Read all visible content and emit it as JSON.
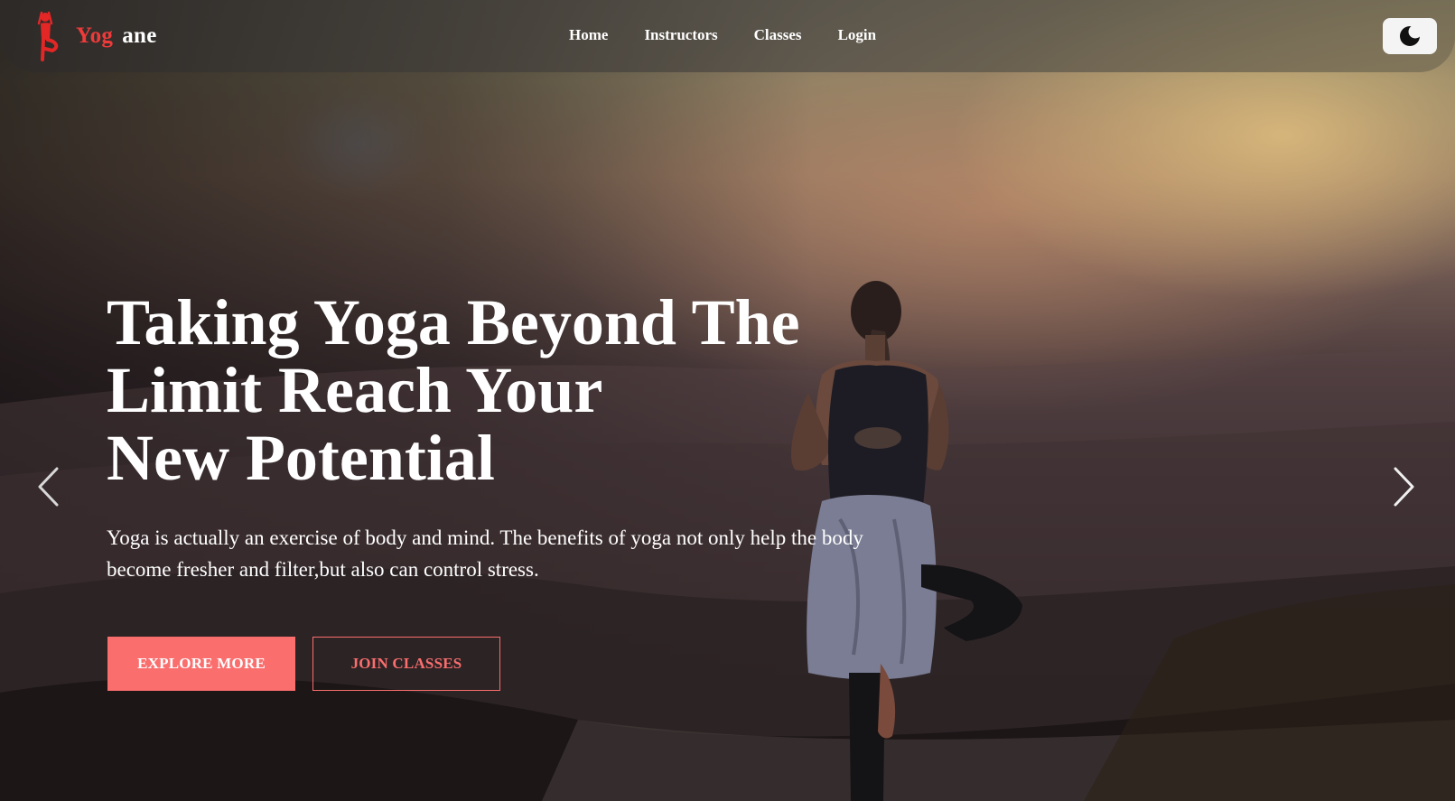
{
  "brand": {
    "name_part1": "Yog",
    "name_part2": "ane",
    "logo_icon": "yoga-pose-icon",
    "accent_color": "#ef3a3a"
  },
  "nav": {
    "links": [
      {
        "label": "Home"
      },
      {
        "label": "Instructors"
      },
      {
        "label": "Classes"
      },
      {
        "label": "Login"
      }
    ],
    "theme_toggle_icon": "moon-icon"
  },
  "hero": {
    "headline_lines": [
      "Taking Yoga Beyond The",
      "Limit Reach Your",
      "New Potential"
    ],
    "subtext_lines": [
      "Yoga is actually an exercise of body and mind. The benefits of yoga not only help the body",
      "become fresher and filter,but also can control stress."
    ],
    "primary_button": "EXPLORE MORE",
    "secondary_button": "JOIN CLASSES",
    "button_color": "#fa6e6e",
    "prev_icon": "chevron-left-icon",
    "next_icon": "chevron-right-icon"
  }
}
